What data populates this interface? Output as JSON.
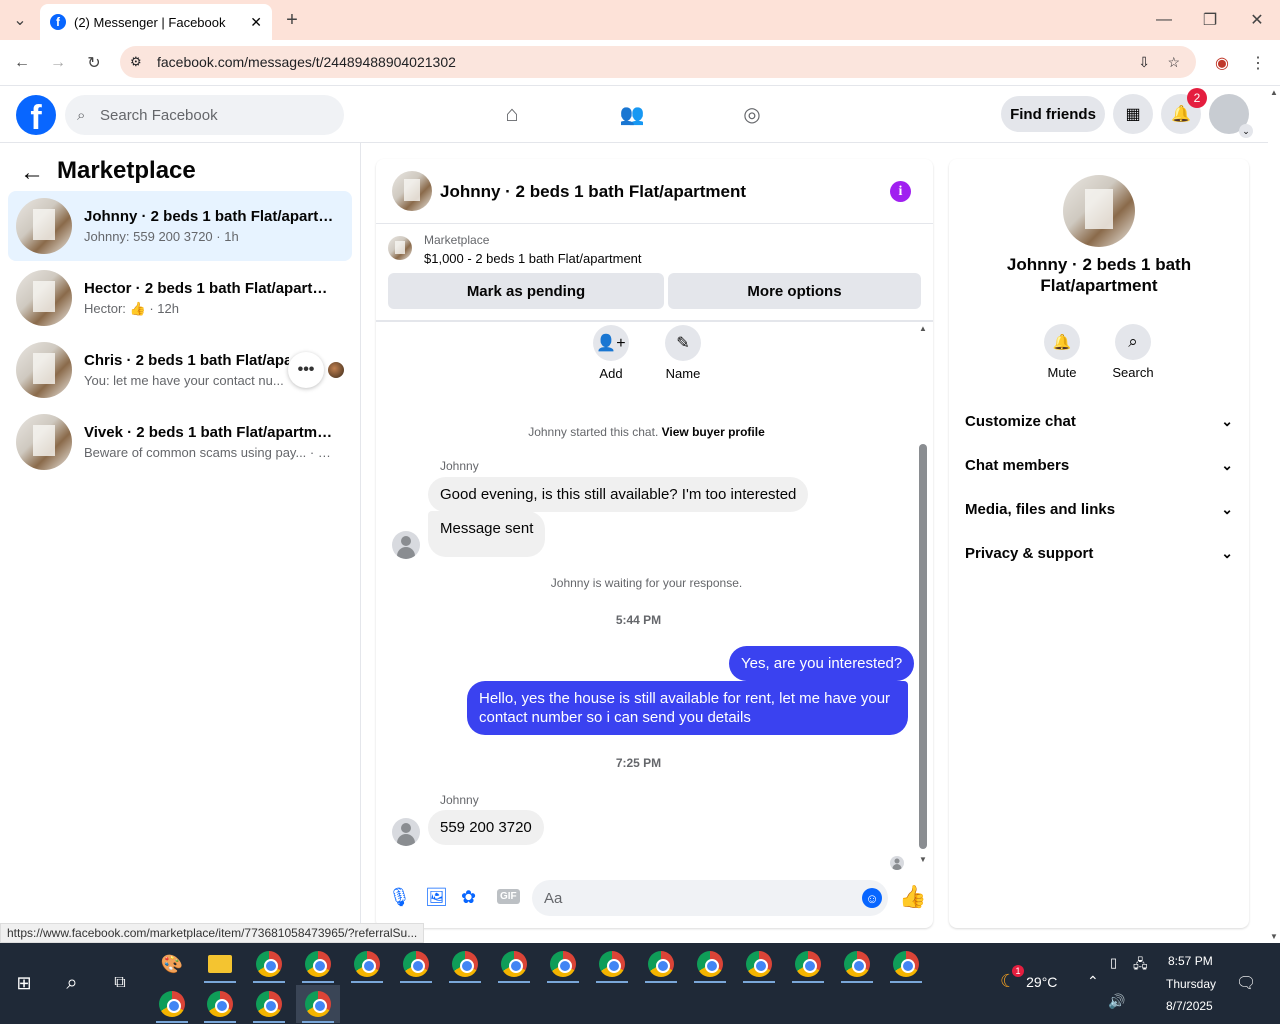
{
  "browser": {
    "tab_title": "(2) Messenger | Facebook",
    "url": "facebook.com/messages/t/24489488904021302",
    "status_url": "https://www.facebook.com/marketplace/item/773681058473965/?referralSu..."
  },
  "fb": {
    "search_placeholder": "Search Facebook",
    "find_friends": "Find friends",
    "notif_count": "2"
  },
  "left": {
    "title": "Marketplace",
    "conversations": [
      {
        "title": "Johnny · 2 beds 1 bath Flat/apartm...",
        "subtitle": "Johnny: 559 200 3720 · 1h"
      },
      {
        "title": "Hector · 2 beds 1 bath Flat/apartm...",
        "subtitle_prefix": "Hector:",
        "subtitle_suffix": "· 12h"
      },
      {
        "title": "Chris · 2 beds 1 bath Flat/apart",
        "subtitle": "You: let me have your contact nu..."
      },
      {
        "title": "Vivek · 2 beds 1 bath Flat/apartment",
        "subtitle": "Beware of common scams using pay... · 19h"
      }
    ]
  },
  "chat": {
    "title": "Johnny · 2 beds 1 bath Flat/apartment",
    "listing_label": "Marketplace",
    "listing_detail": "$1,000 - 2 beds 1 bath Flat/apartment",
    "mark_pending": "Mark as pending",
    "more_options": "More options",
    "add_label": "Add",
    "name_label": "Name",
    "started_text": "Johnny started this chat.",
    "view_profile": "View buyer profile",
    "sender": "Johnny",
    "msg1": "Good evening, is this still available? I'm too interested",
    "msg2": "Message sent",
    "waiting": "Johnny is waiting for your response.",
    "time1": "5:44 PM",
    "my1": "Yes, are you interested?",
    "my2": "Hello, yes the house is still available for rent, let me have your contact number so i can send you details",
    "time2": "7:25 PM",
    "sender2": "Johnny",
    "msg3": "559 200 3720",
    "composer_placeholder": "Aa",
    "gif": "GIF"
  },
  "right": {
    "title": "Johnny · 2 beds 1 bath Flat/apartment",
    "mute": "Mute",
    "search": "Search",
    "sections": [
      "Customize chat",
      "Chat members",
      "Media, files and links",
      "Privacy & support"
    ]
  },
  "taskbar": {
    "weather": "29°C",
    "weather_badge": "1",
    "time": "8:57 PM",
    "day": "Thursday",
    "date": "8/7/2025"
  },
  "colors": {
    "brand": "#0866ff",
    "bubble_blue": "#3a42f0",
    "info": "#a020f0"
  }
}
